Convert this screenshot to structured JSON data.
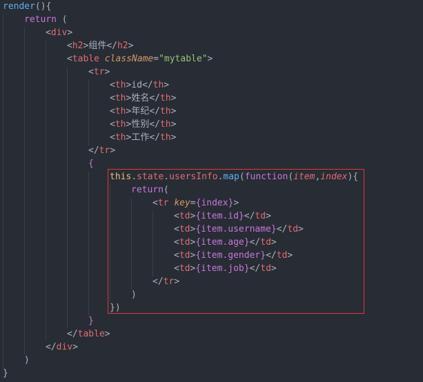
{
  "code": {
    "language": "JavaScript (JSX)",
    "lines": [
      "render(){",
      "    return (",
      "        <div>",
      "            <h2>组件</h2>",
      "            <table className=\"mytable\">",
      "                <tr>",
      "                    <th>id</th>",
      "                    <th>姓名</th>",
      "                    <th>年纪</th>",
      "                    <th>性别</th>",
      "                    <th>工作</th>",
      "                </tr>",
      "                {",
      "                    this.state.usersInfo.map(function(item,index){",
      "                        return(",
      "                            <tr key={index}>",
      "                                <td>{item.id}</td>",
      "                                <td>{item.username}</td>",
      "                                <td>{item.age}</td>",
      "                                <td>{item.gender}</td>",
      "                                <td>{item.job}</td>",
      "                            </tr>",
      "                        )",
      "                    })",
      "                }",
      "            </table>",
      "        </div>",
      "    )",
      "}"
    ],
    "highlighted_range": {
      "from_line": 14,
      "to_line": 24
    }
  },
  "tokens": {
    "l1": {
      "fn": "render",
      "p": "(){"
    },
    "l2": {
      "kw": "return",
      "p": " ("
    },
    "l3": {
      "a": "<",
      "tag": "div",
      "b": ">"
    },
    "l4": {
      "a": "<",
      "tag": "h2",
      "b": ">",
      "txt": "组件",
      "c": "</",
      "tag2": "h2",
      "d": ">"
    },
    "l5": {
      "a": "<",
      "tag": "table",
      "attr": "className",
      "eq": "=",
      "str": "\"mytable\"",
      "b": ">"
    },
    "l6": {
      "a": "<",
      "tag": "tr",
      "b": ">"
    },
    "l7": {
      "a": "<",
      "tag": "th",
      "b": ">",
      "txt": "id",
      "c": "</",
      "tag2": "th",
      "d": ">"
    },
    "l8": {
      "a": "<",
      "tag": "th",
      "b": ">",
      "txt": "姓名",
      "c": "</",
      "tag2": "th",
      "d": ">"
    },
    "l9": {
      "a": "<",
      "tag": "th",
      "b": ">",
      "txt": "年纪",
      "c": "</",
      "tag2": "th",
      "d": ">"
    },
    "l10": {
      "a": "<",
      "tag": "th",
      "b": ">",
      "txt": "性别",
      "c": "</",
      "tag2": "th",
      "d": ">"
    },
    "l11": {
      "a": "<",
      "tag": "th",
      "b": ">",
      "txt": "工作",
      "c": "</",
      "tag2": "th",
      "d": ">"
    },
    "l12": {
      "a": "</",
      "tag": "tr",
      "b": ">"
    },
    "l13": {
      "br": "{"
    },
    "l14": {
      "this": "this",
      "d1": ".",
      "p1": "state",
      "d2": ".",
      "p2": "usersInfo",
      "d3": ".",
      "fn": "map",
      "o": "(",
      "kw": "function",
      "o2": "(",
      "param1": "item",
      "cm": ",",
      "param2": "index",
      "c": "){"
    },
    "l15": {
      "kw": "return",
      "p": "("
    },
    "l16": {
      "a": "<",
      "tag": "tr",
      "attr": "key",
      "eq": "=",
      "expr": "{index}",
      "b": ">"
    },
    "l17": {
      "a": "<",
      "tag": "td",
      "b": ">",
      "expr": "{item.id}",
      "c": "</",
      "tag2": "td",
      "d": ">"
    },
    "l18": {
      "a": "<",
      "tag": "td",
      "b": ">",
      "expr": "{item.username}",
      "c": "</",
      "tag2": "td",
      "d": ">"
    },
    "l19": {
      "a": "<",
      "tag": "td",
      "b": ">",
      "expr": "{item.age}",
      "c": "</",
      "tag2": "td",
      "d": ">"
    },
    "l20": {
      "a": "<",
      "tag": "td",
      "b": ">",
      "expr": "{item.gender}",
      "c": "</",
      "tag2": "td",
      "d": ">"
    },
    "l21": {
      "a": "<",
      "tag": "td",
      "b": ">",
      "expr": "{item.job}",
      "c": "</",
      "tag2": "td",
      "d": ">"
    },
    "l22": {
      "a": "</",
      "tag": "tr",
      "b": ">"
    },
    "l23": {
      "p": ")"
    },
    "l24": {
      "p": "})"
    },
    "l25": {
      "br": "}"
    },
    "l26": {
      "a": "</",
      "tag": "table",
      "b": ">"
    },
    "l27": {
      "a": "</",
      "tag": "div",
      "b": ">"
    },
    "l28": {
      "p": ")"
    },
    "l29": {
      "p": "}"
    }
  },
  "colors": {
    "background": "#282c34",
    "highlight_border": "#e53935",
    "keyword": "#c678dd",
    "function": "#61afef",
    "tag": "#e06c75",
    "attribute": "#d19a66",
    "string": "#98c379",
    "this": "#e5c07b"
  }
}
